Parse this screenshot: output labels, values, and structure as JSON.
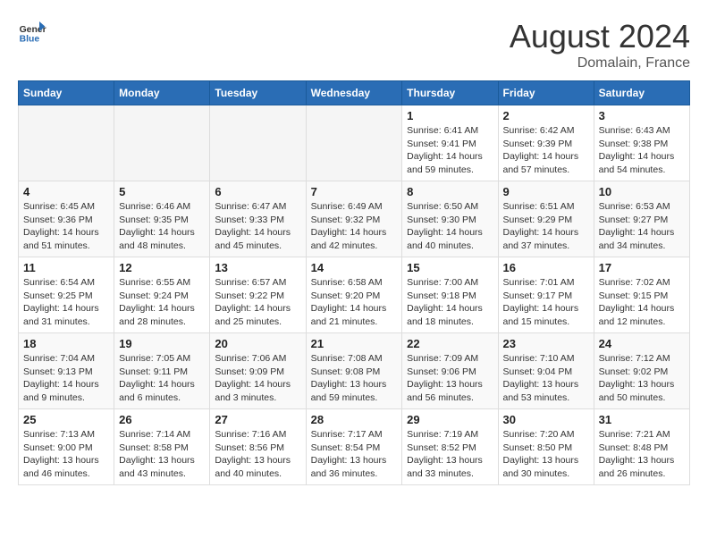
{
  "header": {
    "logo_text_general": "General",
    "logo_text_blue": "Blue",
    "month_title": "August 2024",
    "location": "Domalain, France"
  },
  "calendar": {
    "days_of_week": [
      "Sunday",
      "Monday",
      "Tuesday",
      "Wednesday",
      "Thursday",
      "Friday",
      "Saturday"
    ],
    "weeks": [
      [
        {
          "day": "",
          "info": ""
        },
        {
          "day": "",
          "info": ""
        },
        {
          "day": "",
          "info": ""
        },
        {
          "day": "",
          "info": ""
        },
        {
          "day": "1",
          "info": "Sunrise: 6:41 AM\nSunset: 9:41 PM\nDaylight: 14 hours\nand 59 minutes."
        },
        {
          "day": "2",
          "info": "Sunrise: 6:42 AM\nSunset: 9:39 PM\nDaylight: 14 hours\nand 57 minutes."
        },
        {
          "day": "3",
          "info": "Sunrise: 6:43 AM\nSunset: 9:38 PM\nDaylight: 14 hours\nand 54 minutes."
        }
      ],
      [
        {
          "day": "4",
          "info": "Sunrise: 6:45 AM\nSunset: 9:36 PM\nDaylight: 14 hours\nand 51 minutes."
        },
        {
          "day": "5",
          "info": "Sunrise: 6:46 AM\nSunset: 9:35 PM\nDaylight: 14 hours\nand 48 minutes."
        },
        {
          "day": "6",
          "info": "Sunrise: 6:47 AM\nSunset: 9:33 PM\nDaylight: 14 hours\nand 45 minutes."
        },
        {
          "day": "7",
          "info": "Sunrise: 6:49 AM\nSunset: 9:32 PM\nDaylight: 14 hours\nand 42 minutes."
        },
        {
          "day": "8",
          "info": "Sunrise: 6:50 AM\nSunset: 9:30 PM\nDaylight: 14 hours\nand 40 minutes."
        },
        {
          "day": "9",
          "info": "Sunrise: 6:51 AM\nSunset: 9:29 PM\nDaylight: 14 hours\nand 37 minutes."
        },
        {
          "day": "10",
          "info": "Sunrise: 6:53 AM\nSunset: 9:27 PM\nDaylight: 14 hours\nand 34 minutes."
        }
      ],
      [
        {
          "day": "11",
          "info": "Sunrise: 6:54 AM\nSunset: 9:25 PM\nDaylight: 14 hours\nand 31 minutes."
        },
        {
          "day": "12",
          "info": "Sunrise: 6:55 AM\nSunset: 9:24 PM\nDaylight: 14 hours\nand 28 minutes."
        },
        {
          "day": "13",
          "info": "Sunrise: 6:57 AM\nSunset: 9:22 PM\nDaylight: 14 hours\nand 25 minutes."
        },
        {
          "day": "14",
          "info": "Sunrise: 6:58 AM\nSunset: 9:20 PM\nDaylight: 14 hours\nand 21 minutes."
        },
        {
          "day": "15",
          "info": "Sunrise: 7:00 AM\nSunset: 9:18 PM\nDaylight: 14 hours\nand 18 minutes."
        },
        {
          "day": "16",
          "info": "Sunrise: 7:01 AM\nSunset: 9:17 PM\nDaylight: 14 hours\nand 15 minutes."
        },
        {
          "day": "17",
          "info": "Sunrise: 7:02 AM\nSunset: 9:15 PM\nDaylight: 14 hours\nand 12 minutes."
        }
      ],
      [
        {
          "day": "18",
          "info": "Sunrise: 7:04 AM\nSunset: 9:13 PM\nDaylight: 14 hours\nand 9 minutes."
        },
        {
          "day": "19",
          "info": "Sunrise: 7:05 AM\nSunset: 9:11 PM\nDaylight: 14 hours\nand 6 minutes."
        },
        {
          "day": "20",
          "info": "Sunrise: 7:06 AM\nSunset: 9:09 PM\nDaylight: 14 hours\nand 3 minutes."
        },
        {
          "day": "21",
          "info": "Sunrise: 7:08 AM\nSunset: 9:08 PM\nDaylight: 13 hours\nand 59 minutes."
        },
        {
          "day": "22",
          "info": "Sunrise: 7:09 AM\nSunset: 9:06 PM\nDaylight: 13 hours\nand 56 minutes."
        },
        {
          "day": "23",
          "info": "Sunrise: 7:10 AM\nSunset: 9:04 PM\nDaylight: 13 hours\nand 53 minutes."
        },
        {
          "day": "24",
          "info": "Sunrise: 7:12 AM\nSunset: 9:02 PM\nDaylight: 13 hours\nand 50 minutes."
        }
      ],
      [
        {
          "day": "25",
          "info": "Sunrise: 7:13 AM\nSunset: 9:00 PM\nDaylight: 13 hours\nand 46 minutes."
        },
        {
          "day": "26",
          "info": "Sunrise: 7:14 AM\nSunset: 8:58 PM\nDaylight: 13 hours\nand 43 minutes."
        },
        {
          "day": "27",
          "info": "Sunrise: 7:16 AM\nSunset: 8:56 PM\nDaylight: 13 hours\nand 40 minutes."
        },
        {
          "day": "28",
          "info": "Sunrise: 7:17 AM\nSunset: 8:54 PM\nDaylight: 13 hours\nand 36 minutes."
        },
        {
          "day": "29",
          "info": "Sunrise: 7:19 AM\nSunset: 8:52 PM\nDaylight: 13 hours\nand 33 minutes."
        },
        {
          "day": "30",
          "info": "Sunrise: 7:20 AM\nSunset: 8:50 PM\nDaylight: 13 hours\nand 30 minutes."
        },
        {
          "day": "31",
          "info": "Sunrise: 7:21 AM\nSunset: 8:48 PM\nDaylight: 13 hours\nand 26 minutes."
        }
      ]
    ]
  }
}
